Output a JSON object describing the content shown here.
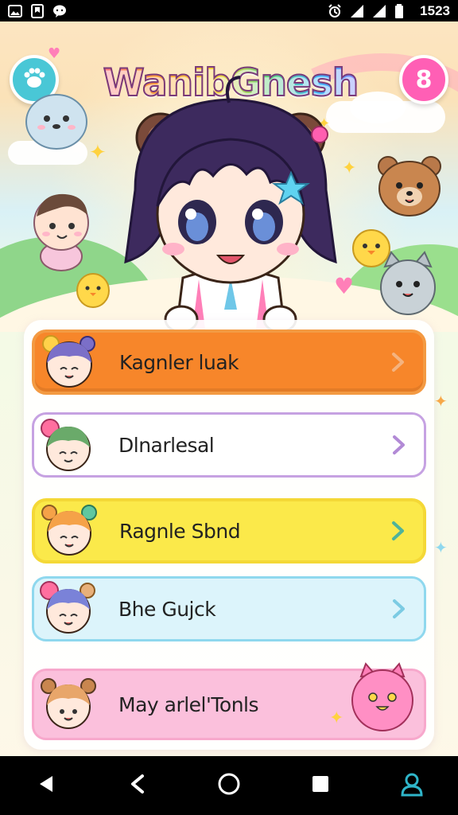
{
  "status_bar": {
    "time": "1523",
    "left_icons": [
      "image-icon",
      "bookmark-icon",
      "chat-bubble-icon"
    ],
    "right_icons": [
      "alarm-icon",
      "signal-icon",
      "signal-icon",
      "battery-icon"
    ]
  },
  "header": {
    "title": "WanibGnesh",
    "left_button_icon": "paw-icon",
    "right_button_text": "8"
  },
  "menu": {
    "items": [
      {
        "label": "Kagnler luak",
        "color": "#f7862a",
        "arrow_color": "#f4b37f"
      },
      {
        "label": "Dlnarlesal",
        "color": "#ffffff",
        "arrow_color": "#b28ad6"
      },
      {
        "label": "Ragnle Sbnd",
        "color": "#fbe94a",
        "arrow_color": "#4fb39a"
      },
      {
        "label": "Bhe Gujck",
        "color": "#dcf4fb",
        "arrow_color": "#7ccbe3"
      },
      {
        "label": "May arlel'Tonls",
        "color": "#fbc0dc",
        "arrow_color": "#f08bbb"
      }
    ]
  },
  "nav": {
    "buttons": [
      "back-icon",
      "share-icon",
      "home-icon",
      "recents-icon",
      "profile-icon"
    ],
    "profile_color": "#2fb5c9"
  }
}
